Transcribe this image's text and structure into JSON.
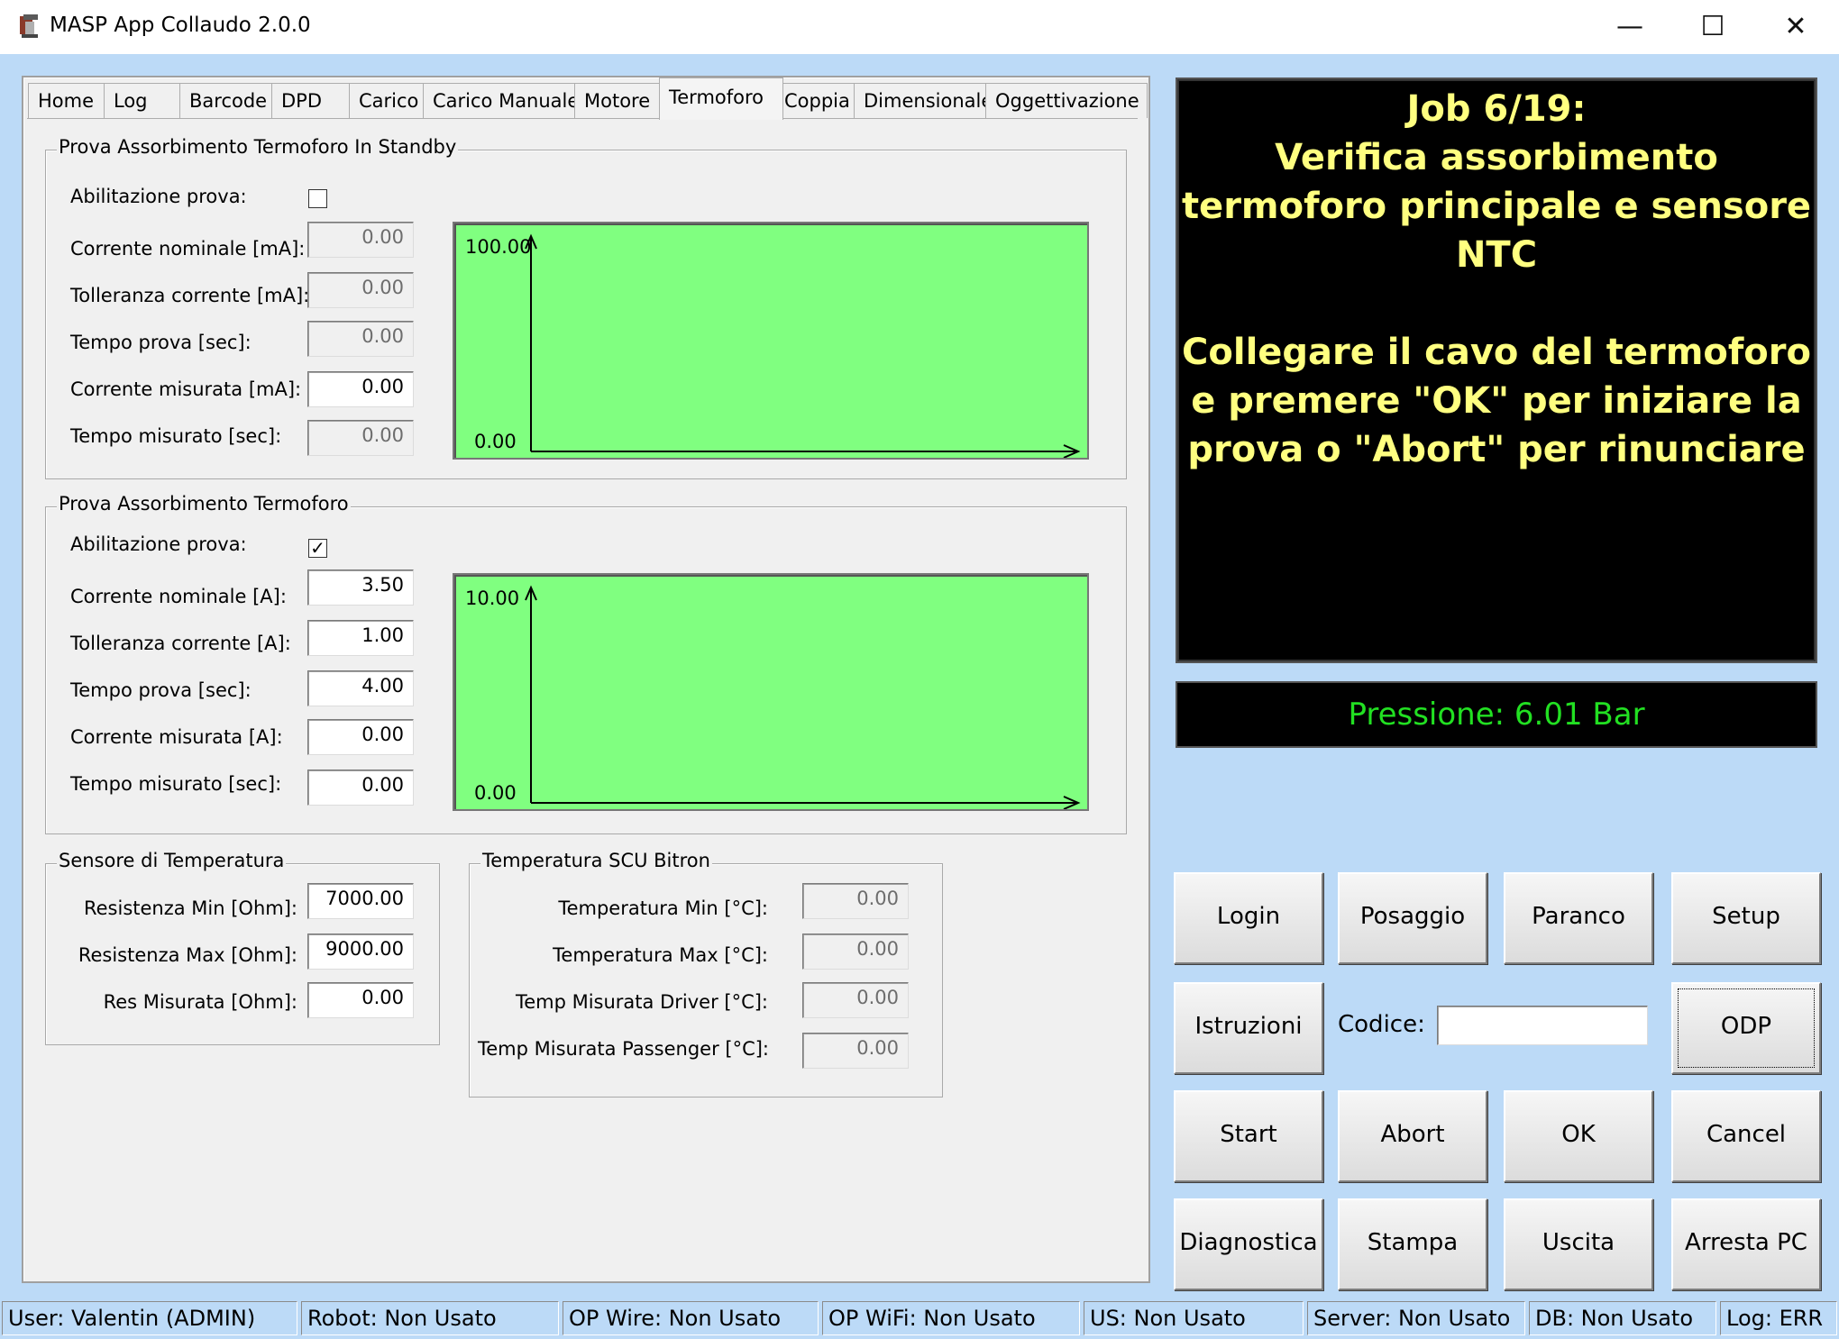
{
  "window": {
    "title": "MASP App Collaudo 2.0.0",
    "minimize_glyph": "—",
    "maximize_glyph": "☐",
    "close_glyph": "✕"
  },
  "tabs": [
    {
      "label": "Home"
    },
    {
      "label": "Log"
    },
    {
      "label": "Barcode"
    },
    {
      "label": "DPD"
    },
    {
      "label": "Carico"
    },
    {
      "label": "Carico Manuale"
    },
    {
      "label": "Motore"
    },
    {
      "label": "Termoforo"
    },
    {
      "label": "Coppia"
    },
    {
      "label": "Dimensionale"
    },
    {
      "label": "Oggettivazione"
    }
  ],
  "active_tab": "Termoforo",
  "standby": {
    "title": "Prova Assorbimento Termoforo In Standby",
    "enable_label": "Abilitazione prova:",
    "enabled": false,
    "fields": [
      {
        "label": "Corrente nominale [mA]:",
        "value": "0.00"
      },
      {
        "label": "Tolleranza corrente [mA]:",
        "value": "0.00"
      },
      {
        "label": "Tempo prova [sec]:",
        "value": "0.00"
      },
      {
        "label": "Corrente misurata [mA]:",
        "value": "0.00"
      },
      {
        "label": "Tempo misurato [sec]:",
        "value": "0.00"
      }
    ],
    "chart": {
      "ymax_label": "100.00",
      "ymin_label": "0.00"
    }
  },
  "main_test": {
    "title": "Prova Assorbimento Termoforo",
    "enable_label": "Abilitazione prova:",
    "enabled": true,
    "check_glyph": "✓",
    "fields": [
      {
        "label": "Corrente nominale [A]:",
        "value": "3.50"
      },
      {
        "label": "Tolleranza corrente [A]:",
        "value": "1.00"
      },
      {
        "label": "Tempo prova [sec]:",
        "value": "4.00"
      },
      {
        "label": "Corrente misurata [A]:",
        "value": "0.00"
      },
      {
        "label": "Tempo misurato [sec]:",
        "value": "0.00"
      }
    ],
    "chart": {
      "ymax_label": "10.00",
      "ymin_label": "0.00"
    }
  },
  "sensor": {
    "title": "Sensore di Temperatura",
    "fields": [
      {
        "label": "Resistenza Min [Ohm]:",
        "value": "7000.00"
      },
      {
        "label": "Resistenza Max [Ohm]:",
        "value": "9000.00"
      },
      {
        "label": "Res Misurata [Ohm]:",
        "value": "0.00"
      }
    ]
  },
  "scu": {
    "title": "Temperatura SCU Bitron",
    "fields": [
      {
        "label": "Temperatura Min [°C]:",
        "value": "0.00"
      },
      {
        "label": "Temperatura Max [°C]:",
        "value": "0.00"
      },
      {
        "label": "Temp Misurata Driver [°C]:",
        "value": "0.00"
      },
      {
        "label": "Temp Misurata Passenger [°C]:",
        "value": "0.00"
      }
    ]
  },
  "job": {
    "lines": [
      "Job 6/19:",
      "Verifica assorbimento",
      "termoforo principale e sensore",
      "NTC",
      "",
      "Collegare il cavo del termoforo",
      "e premere \"OK\" per iniziare la",
      "prova o \"Abort\" per rinunciare"
    ]
  },
  "pressure": "Pressione: 6.01 Bar",
  "buttons": {
    "login": "Login",
    "posaggio": "Posaggio",
    "paranco": "Paranco",
    "setup": "Setup",
    "istruzioni": "Istruzioni",
    "codice_label": "Codice:",
    "codice_value": "",
    "odp": "ODP",
    "start": "Start",
    "abort": "Abort",
    "ok": "OK",
    "cancel": "Cancel",
    "diagnostica": "Diagnostica",
    "stampa": "Stampa",
    "uscita": "Uscita",
    "arresta": "Arresta PC"
  },
  "status": [
    "User: Valentin (ADMIN)",
    "Robot: Non Usato",
    "OP Wire: Non Usato",
    "OP WiFi: Non Usato",
    "US: Non Usato",
    "Server: Non Usato",
    "DB: Non Usato",
    "Log: ERR"
  ],
  "colors": {
    "chart_bg": "#80ff80",
    "job_text": "#ffff80",
    "pressure_text": "#22e022",
    "client_bg": "#bcdaf7"
  }
}
